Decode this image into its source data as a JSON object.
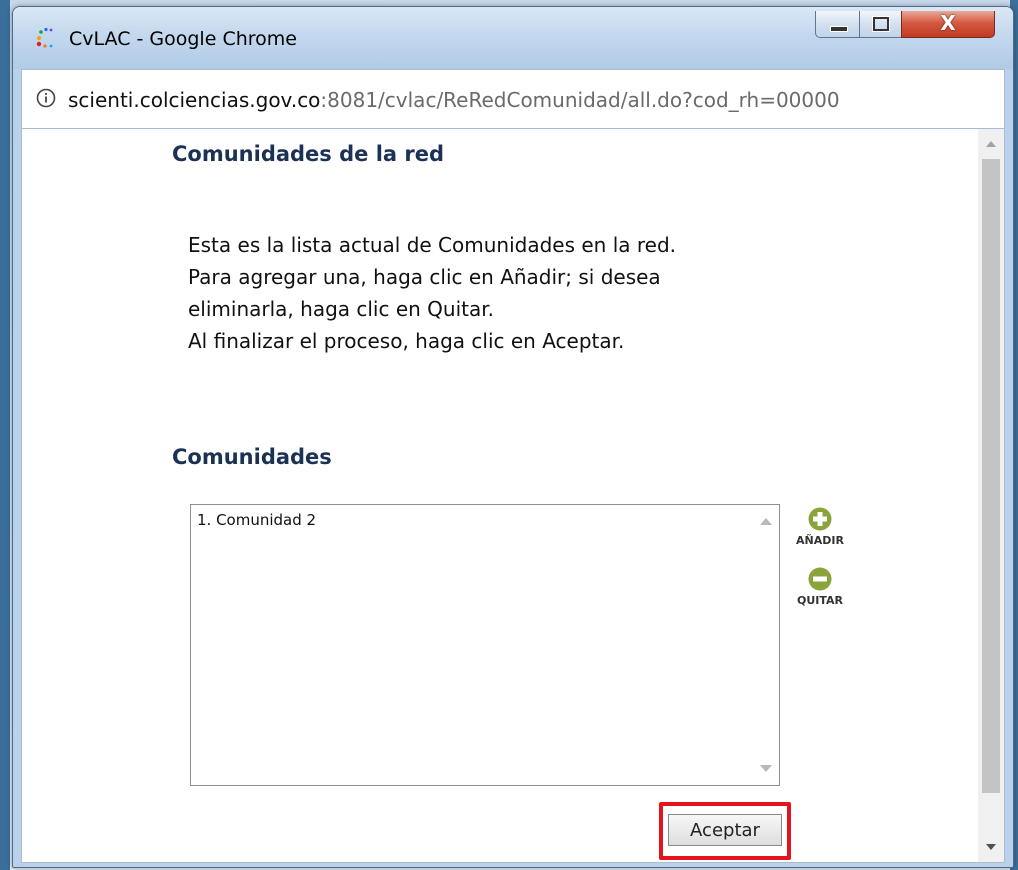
{
  "window": {
    "title": "CvLAC - Google Chrome",
    "close_glyph": "X"
  },
  "address_bar": {
    "url_host": "scienti.colciencias.gov.co",
    "url_rest": ":8081/cvlac/ReRedComunidad/all.do?cod_rh=00000"
  },
  "page": {
    "title": "Comunidades de la red",
    "instructions": [
      "Esta es la lista actual de Comunidades en la red.",
      "Para agregar una, haga clic en Añadir; si desea",
      "eliminarla, haga clic en Quitar.",
      "Al finalizar el proceso, haga clic en Aceptar."
    ],
    "section_title": "Comunidades",
    "list_items": [
      "1. Comunidad 2"
    ],
    "add_label": "AÑADIR",
    "remove_label": "QUITAR",
    "accept_label": "Aceptar"
  },
  "colors": {
    "heading": "#1c3254",
    "action_icon": "#8aa33a",
    "highlight_border": "#e5131b"
  },
  "icons": {
    "app": "cvlac-logo-icon",
    "info": "info-icon",
    "add": "plus-circle-icon",
    "remove": "minus-circle-icon"
  }
}
